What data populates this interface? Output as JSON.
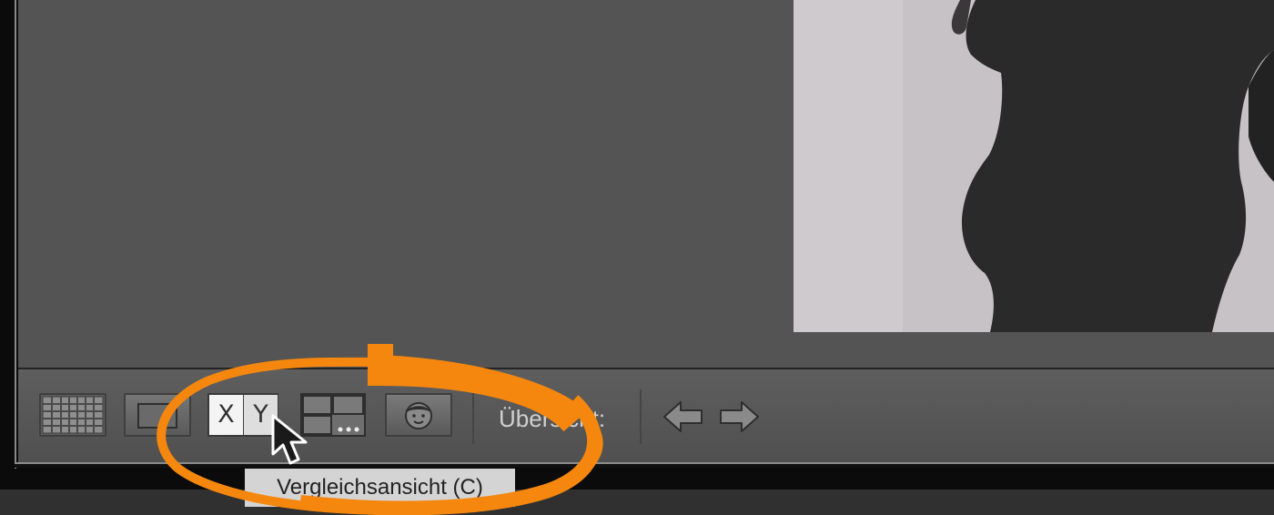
{
  "toolbar": {
    "buttons": [
      {
        "id": "grid",
        "icon": "grid-view-icon",
        "tooltip": ""
      },
      {
        "id": "loupe",
        "icon": "loupe-view-icon",
        "tooltip": ""
      },
      {
        "id": "compare",
        "icon": "compare-view-icon",
        "x_label": "X",
        "y_label": "Y",
        "active": true
      },
      {
        "id": "survey",
        "icon": "survey-view-icon",
        "dots": "..."
      },
      {
        "id": "people",
        "icon": "people-view-icon"
      }
    ],
    "overview_label": "Übersicht:",
    "prev_icon": "arrow-left-icon",
    "next_icon": "arrow-right-icon"
  },
  "tooltip": {
    "text": "Vergleichsansicht (C)"
  },
  "highlight": {
    "color": "#f5870f"
  },
  "colors": {
    "view_background": "#545454",
    "toolbar_background": "#585858",
    "text": "#d0d0d0"
  }
}
